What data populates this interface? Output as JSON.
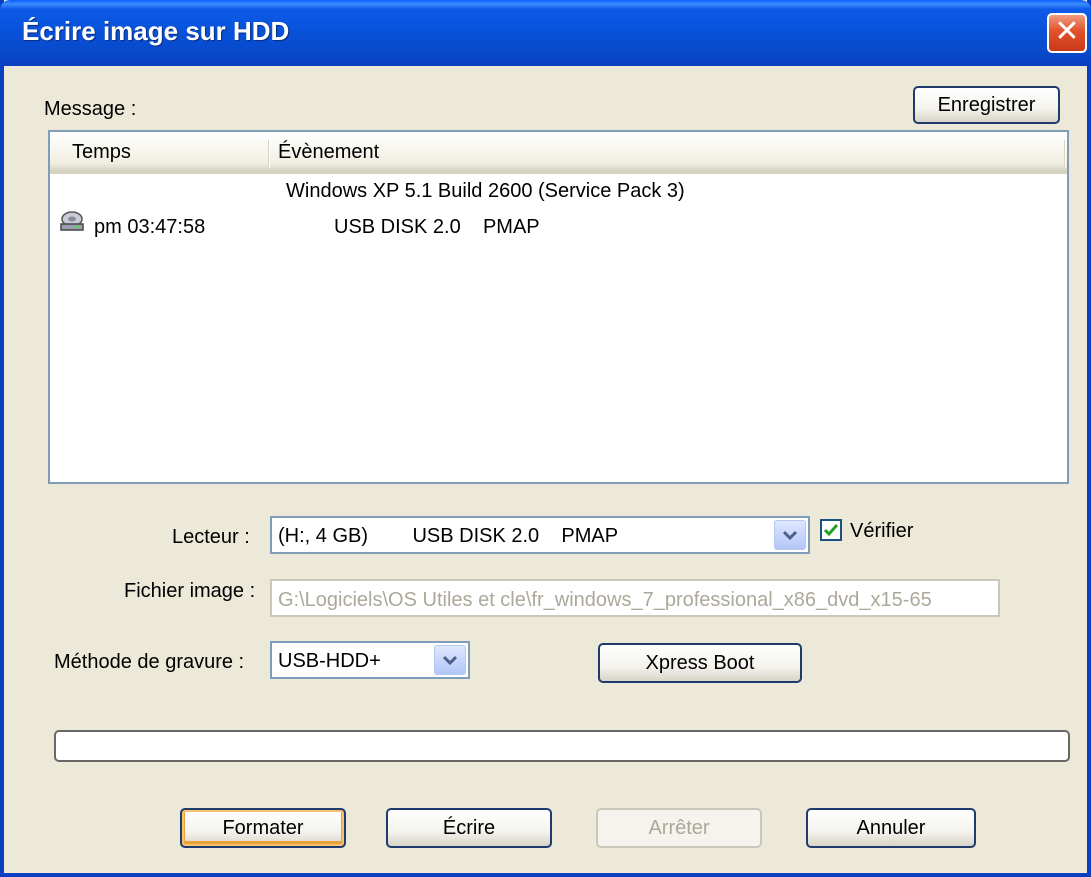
{
  "window": {
    "title": "Écrire image sur HDD",
    "close_icon": "close-icon"
  },
  "message": {
    "label": "Message :",
    "save_button": "Enregistrer",
    "columns": [
      "Temps",
      "Évènement"
    ],
    "rows": [
      {
        "time": "",
        "event": "Windows XP 5.1 Build 2600 (Service Pack 3)",
        "icon": ""
      },
      {
        "time": "pm 03:47:58",
        "event": "USB DISK 2.0    PMAP",
        "icon": "disk-drive-icon"
      }
    ]
  },
  "drive": {
    "label": "Lecteur :",
    "value": "(H:, 4 GB)        USB DISK 2.0    PMAP",
    "verify_label": "Vérifier",
    "verify_checked": true
  },
  "image_file": {
    "label": "Fichier image :",
    "value": "G:\\Logiciels\\OS Utiles et cle\\fr_windows_7_professional_x86_dvd_x15-65"
  },
  "write_method": {
    "label": "Méthode de gravure :",
    "value": "USB-HDD+",
    "xpress_boot_button": "Xpress Boot"
  },
  "progress": {
    "value": 0
  },
  "buttons": {
    "format": "Formater",
    "write": "Écrire",
    "stop": "Arrêter",
    "cancel": "Annuler"
  },
  "colors": {
    "titlebar": "#0852d8",
    "dialog_bg": "#ece9d8",
    "close_button": "#e0522a",
    "check_mark": "#21a121"
  }
}
